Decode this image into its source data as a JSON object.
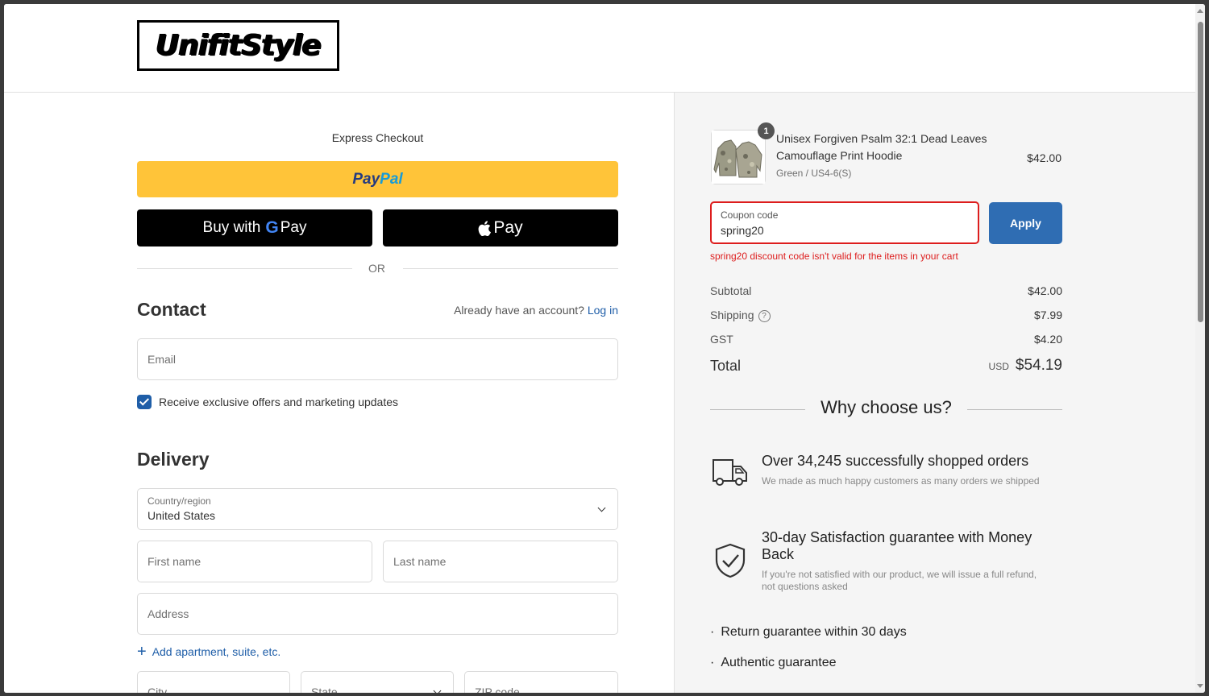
{
  "brand": {
    "logo_text": "UnifitStyle"
  },
  "express": {
    "title": "Express Checkout",
    "paypal_part1": "Pay",
    "paypal_part2": "Pal",
    "gpay_prefix": "Buy with",
    "gpay_g": "G",
    "gpay_suffix": "Pay",
    "apay_label": "Pay",
    "or_text": "OR"
  },
  "contact": {
    "title": "Contact",
    "login_prompt": "Already have an account?",
    "login_link": "Log in",
    "email_placeholder": "Email",
    "marketing_label": "Receive exclusive offers and marketing updates",
    "marketing_checked": true
  },
  "delivery": {
    "title": "Delivery",
    "country_label": "Country/region",
    "country_value": "United States",
    "first_name_placeholder": "First name",
    "last_name_placeholder": "Last name",
    "address_placeholder": "Address",
    "add_apartment": "Add apartment, suite, etc.",
    "city_placeholder": "City",
    "state_placeholder": "State",
    "zip_placeholder": "ZIP code"
  },
  "order": {
    "item": {
      "quantity": "1",
      "name": "Unisex Forgiven Psalm 32:1 Dead Leaves Camouflage Print Hoodie",
      "variant": "Green / US4-6(S)",
      "price": "$42.00"
    },
    "coupon": {
      "label": "Coupon code",
      "value": "spring20",
      "apply_label": "Apply",
      "error": "spring20 discount code isn't valid for the items in your cart"
    },
    "summary": {
      "subtotal_label": "Subtotal",
      "subtotal": "$42.00",
      "shipping_label": "Shipping",
      "shipping": "$7.99",
      "gst_label": "GST",
      "gst": "$4.20",
      "total_label": "Total",
      "currency": "USD",
      "total": "$54.19"
    }
  },
  "why": {
    "title": "Why choose us?",
    "features": [
      {
        "title": "Over 34,245 successfully shopped orders",
        "desc": "We made as much happy customers as many orders we shipped",
        "icon": "truck-icon"
      },
      {
        "title": "30-day Satisfaction guarantee with Money Back",
        "desc": "If you're not satisfied with our product, we will issue a full refund, not questions asked",
        "icon": "shield-check-icon"
      }
    ],
    "bullets": [
      "Return guarantee within 30 days",
      "Authentic guarantee"
    ]
  },
  "colors": {
    "paypal_yellow": "#ffc439",
    "link_blue": "#1f5ea8",
    "apply_blue": "#2f6db3",
    "error_red": "#dd1d1d"
  }
}
